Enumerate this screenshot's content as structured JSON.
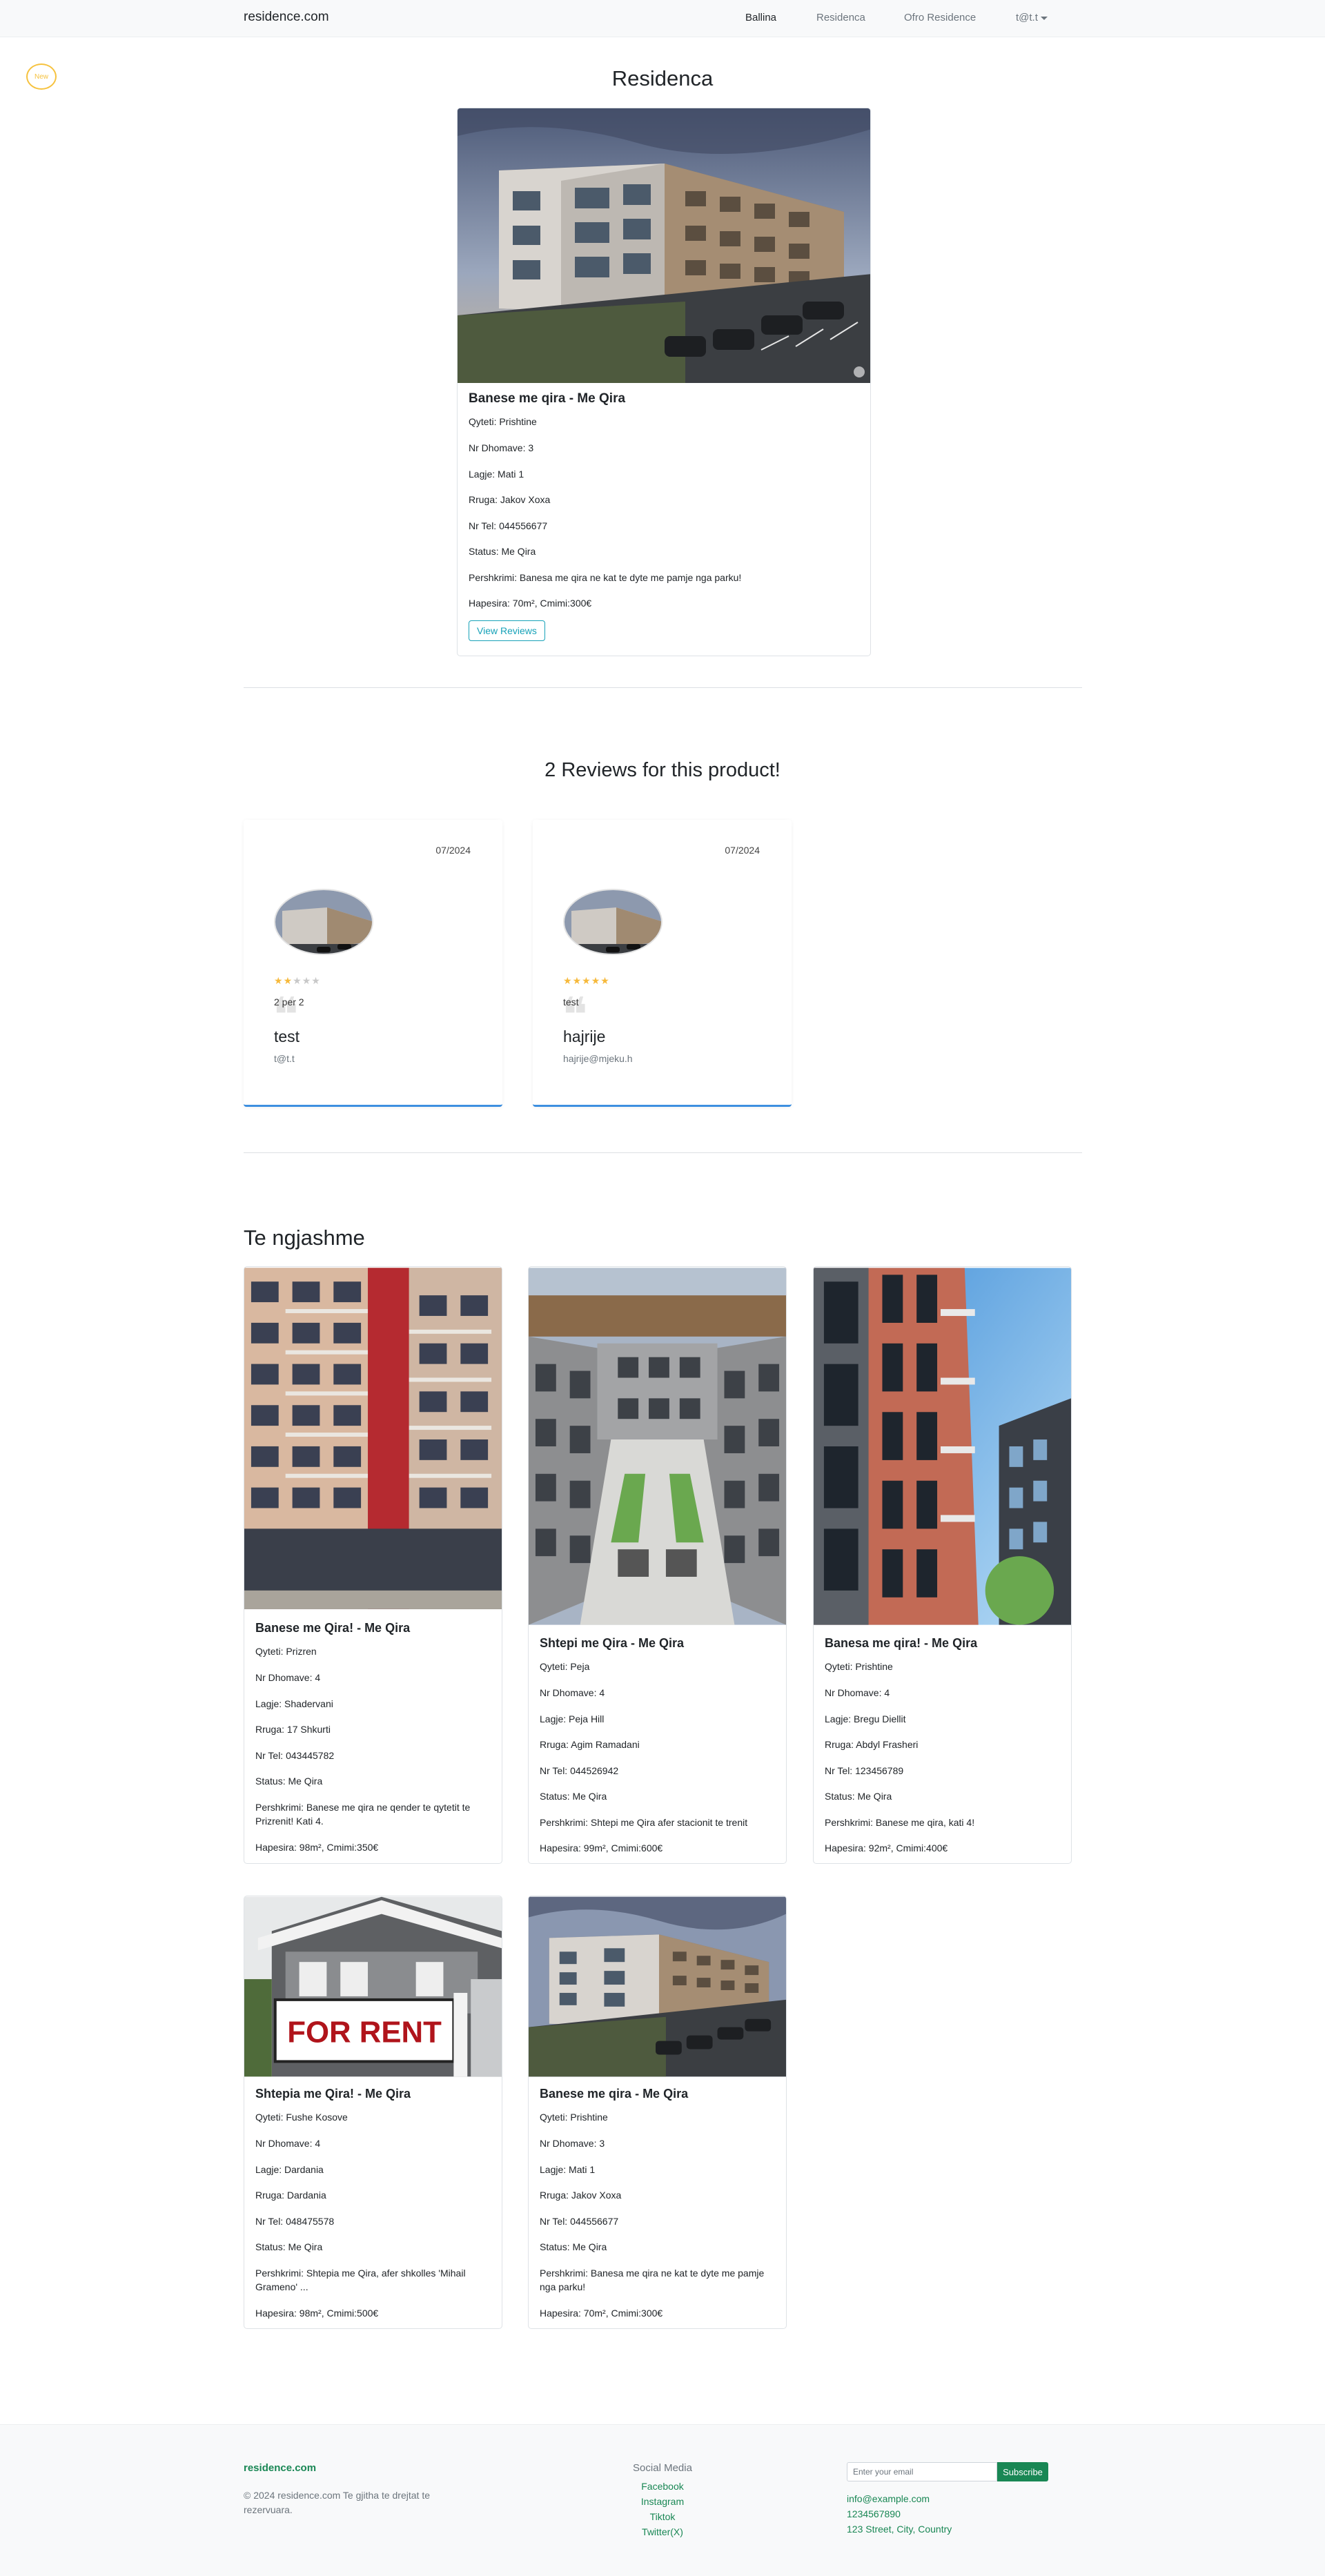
{
  "navbar": {
    "brand": "residence.com",
    "links": [
      "Ballina",
      "Residenca",
      "Ofro Residence",
      "t@t.t"
    ]
  },
  "badge": "New",
  "page_title": "Residenca",
  "main_listing": {
    "title": "Banese me qira - Me Qira",
    "lines": [
      "Qyteti: Prishtine",
      "Nr Dhomave: 3",
      "Lagje: Mati 1",
      "Rruga: Jakov Xoxa",
      "Nr Tel: 044556677",
      "Status: Me Qira",
      "Pershkrimi: Banesa me qira ne kat te dyte me pamje nga parku!",
      "Hapesira: 70m², Cmimi:300€"
    ],
    "button": "View Reviews"
  },
  "reviews": {
    "title": "2 Reviews for this product!",
    "items": [
      {
        "date": "07/2024",
        "rating": 2,
        "text": "2 per 2",
        "name": "test",
        "email": "t@t.t"
      },
      {
        "date": "07/2024",
        "rating": 5,
        "text": "test",
        "name": "hajrije",
        "email": "hajrije@mjeku.h"
      }
    ]
  },
  "similar": {
    "title": "Te ngjashme",
    "items": [
      {
        "title": "Banese me Qira! - Me Qira",
        "lines": [
          "Qyteti: Prizren",
          "Nr Dhomave: 4",
          "Lagje: Shadervani",
          "Rruga: 17 Shkurti",
          "Nr Tel: 043445782",
          "Status: Me Qira",
          "Pershkrimi: Banese me qira ne qender te qytetit te Prizrenit! Kati 4.",
          "Hapesira: 98m², Cmimi:350€"
        ]
      },
      {
        "title": "Shtepi me Qira - Me Qira",
        "lines": [
          "Qyteti: Peja",
          "Nr Dhomave: 4",
          "Lagje: Peja Hill",
          "Rruga: Agim Ramadani",
          "Nr Tel: 044526942",
          "Status: Me Qira",
          "Pershkrimi: Shtepi me Qira afer stacionit te trenit",
          "Hapesira: 99m², Cmimi:600€"
        ]
      },
      {
        "title": "Banesa me qira! - Me Qira",
        "lines": [
          "Qyteti: Prishtine",
          "Nr Dhomave: 4",
          "Lagje: Bregu Diellit",
          "Rruga: Abdyl Frasheri",
          "Nr Tel: 123456789",
          "Status: Me Qira",
          "Pershkrimi: Banese me qira, kati 4!",
          "Hapesira: 92m², Cmimi:400€"
        ]
      },
      {
        "title": "Shtepia me Qira! - Me Qira",
        "lines": [
          "Qyteti: Fushe Kosove",
          "Nr Dhomave: 4",
          "Lagje: Dardania",
          "Rruga: Dardania",
          "Nr Tel: 048475578",
          "Status: Me Qira",
          "Pershkrimi: Shtepia me Qira, afer shkolles 'Mihail Grameno' ...",
          "Hapesira: 98m², Cmimi:500€"
        ],
        "sign_text": "FOR RENT"
      },
      {
        "title": "Banese me qira - Me Qira",
        "lines": [
          "Qyteti: Prishtine",
          "Nr Dhomave: 3",
          "Lagje: Mati 1",
          "Rruga: Jakov Xoxa",
          "Nr Tel: 044556677",
          "Status: Me Qira",
          "Pershkrimi: Banesa me qira ne kat te dyte me pamje nga parku!",
          "Hapesira: 70m², Cmimi:300€"
        ]
      }
    ]
  },
  "footer": {
    "brand": "residence.com",
    "copyright": "© 2024 residence.com Te gjitha te drejtat te rezervuara.",
    "social_title": "Social Media",
    "social_links": [
      "Facebook",
      "Instagram",
      "Tiktok",
      "Twitter(X)"
    ],
    "email_placeholder": "Enter your email",
    "subscribe": "Subscribe",
    "contact": [
      "info@example.com",
      "1234567890",
      "123 Street, City, Country"
    ]
  }
}
